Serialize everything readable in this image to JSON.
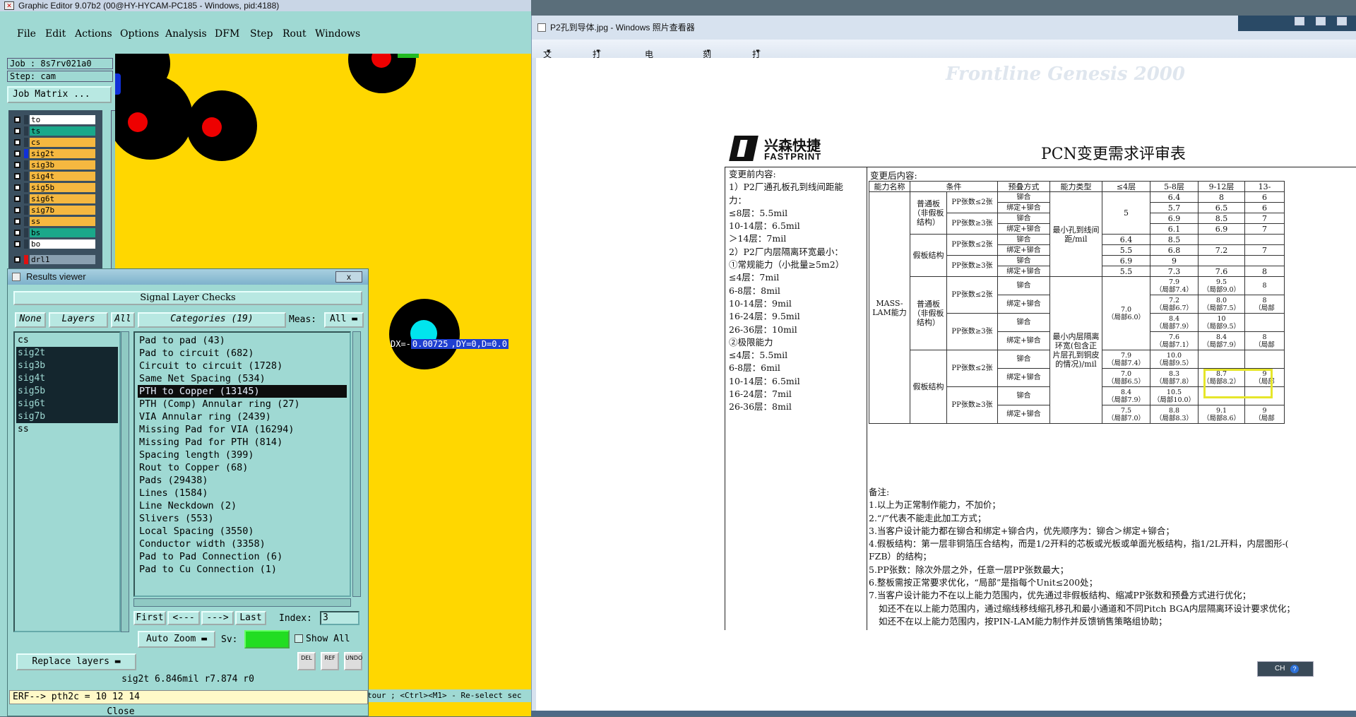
{
  "graphic_editor": {
    "title": "Graphic Editor 9.07b2 (00@HY-HYCAM-PC185 - Windows, pid:4188)",
    "menu": [
      "File",
      "Edit",
      "Actions",
      "Options",
      "Analysis",
      "DFM",
      "Step",
      "Rout",
      "Windows"
    ],
    "job": "Job : 8s7rv021a0",
    "step": "Step: cam",
    "job_matrix": "Job Matrix ...",
    "layers": [
      {
        "name": "to",
        "color": "#ffffff"
      },
      {
        "name": "ts",
        "color": "#1aa88a"
      },
      {
        "name": "cs",
        "color": "#f5b840"
      },
      {
        "name": "sig2t",
        "color": "#f5b840"
      },
      {
        "name": "sig3b",
        "color": "#f5b840"
      },
      {
        "name": "sig4t",
        "color": "#f5b840"
      },
      {
        "name": "sig5b",
        "color": "#f5b840"
      },
      {
        "name": "sig6t",
        "color": "#f5b840"
      },
      {
        "name": "sig7b",
        "color": "#f5b840"
      },
      {
        "name": "ss",
        "color": "#f5b840"
      },
      {
        "name": "bs",
        "color": "#1aa88a"
      },
      {
        "name": "bo",
        "color": "#ffffff"
      }
    ],
    "drill_layer": "drl1",
    "measure_label": {
      "prefix": "DX=-",
      "value": "0.00725",
      "rest": ",DY=0,D=0.0"
    },
    "bottom_strip": "tour ; <Ctrl><M1> - Re-select sec"
  },
  "results_viewer": {
    "title": "Results viewer",
    "close_label": "x",
    "header": "Signal Layer Checks",
    "btn_none": "None",
    "btn_layers": "Layers",
    "btn_all": "All",
    "btn_categories": "Categories (19)",
    "meas_label": "Meas:",
    "meas_value": "All",
    "layers": [
      {
        "name": "cs",
        "sel": false
      },
      {
        "name": "sig2t",
        "sel": true
      },
      {
        "name": "sig3b",
        "sel": true
      },
      {
        "name": "sig4t",
        "sel": true
      },
      {
        "name": "sig5b",
        "sel": true
      },
      {
        "name": "sig6t",
        "sel": true
      },
      {
        "name": "sig7b",
        "sel": true
      },
      {
        "name": "ss",
        "sel": false
      }
    ],
    "categories": [
      {
        "label": "Pad to pad (43)",
        "sel": false
      },
      {
        "label": "Pad to circuit (682)",
        "sel": false
      },
      {
        "label": "Circuit to circuit (1728)",
        "sel": false
      },
      {
        "label": "Same Net Spacing (534)",
        "sel": false
      },
      {
        "label": "PTH to Copper (13145)",
        "sel": true
      },
      {
        "label": "PTH (Comp) Annular ring (27)",
        "sel": false
      },
      {
        "label": "VIA Annular ring (2439)",
        "sel": false
      },
      {
        "label": "Missing Pad for VIA (16294)",
        "sel": false
      },
      {
        "label": "Missing Pad for PTH (814)",
        "sel": false
      },
      {
        "label": "Spacing length (399)",
        "sel": false
      },
      {
        "label": "Rout to Copper (68)",
        "sel": false
      },
      {
        "label": "Pads (29438)",
        "sel": false
      },
      {
        "label": "Lines (1584)",
        "sel": false
      },
      {
        "label": "Line Neckdown (2)",
        "sel": false
      },
      {
        "label": "Slivers (553)",
        "sel": false
      },
      {
        "label": "Local Spacing (3550)",
        "sel": false
      },
      {
        "label": "Conductor width (3358)",
        "sel": false
      },
      {
        "label": "Pad to Pad Connection (6)",
        "sel": false
      },
      {
        "label": "Pad to Cu Connection (1)",
        "sel": false
      }
    ],
    "nav": {
      "first": "First",
      "prev": "<---",
      "next": "--->",
      "last": "Last",
      "index_label": "Index:",
      "index_value": "3"
    },
    "auto_zoom": "Auto Zoom",
    "sv_label": "Sv:",
    "show_all": "Show All",
    "replace_layers": "Replace layers",
    "icon_btns": [
      "DEL",
      "REF",
      "UNDO"
    ],
    "status": "sig2t 6.846mil  r7.874  r0",
    "erf": "ERF--> pth2c = 10 12 14",
    "close": "Close"
  },
  "photo_viewer": {
    "title": "P2孔到导体.jpg - Windows 照片查看器",
    "menu": [
      "文件(F)",
      "打印(P)",
      "电子邮件(E)",
      "刻录(U)",
      "打开(O)"
    ],
    "ghost_text": "Frontline  Genesis 2000",
    "document": {
      "logo_cn": "兴森快捷",
      "logo_en": "FASTPRINT",
      "title": "PCN变更需求评审表",
      "before_heading": "变更前内容:",
      "after_heading": "变更后内容:",
      "before_lines": [
        "1）P2厂通孔板孔到线间距能",
        "力：",
        "≤8层：5.5mil",
        "10-14层：6.5mil",
        "＞14层：7mil",
        "2）P2厂内层隔离环宽最小：",
        "①常规能力（小批量≥5m2）",
        "≤4层：7mil",
        "6-8层：8mil",
        "10-14层：9mil",
        "16-24层：9.5mil",
        "26-36层：10mil",
        "②极限能力",
        "≤4层：5.5mil",
        "6-8层：6mil",
        "10-14层：6.5mil",
        "16-24层：7mil",
        "26-36层：8mil"
      ],
      "table_headers": [
        "能力名称",
        "条件",
        "预叠方式",
        "能力类型",
        "≤4层",
        "5-8层",
        "9-12层",
        "13-"
      ],
      "capability_name": "MASS-LAM能力",
      "board_normal": "普通板（非假板结构）",
      "board_dummy": "假板结构",
      "pp_le2": "PP张数≤2张",
      "pp_ge3": "PP张数≥3张",
      "m_rivet": "铆合",
      "m_bond_rivet": "绑定+铆合",
      "type_hole": "最小孔到线间距/mil",
      "type_ring": "最小内层隔离环宽(包含正片层孔到铜皮的情况)/mil",
      "hole_rows": [
        [
          "",
          "6.4",
          "8",
          "6"
        ],
        [
          "",
          "5.7",
          "6.5",
          "6"
        ],
        [
          "",
          "6.9",
          "8.5",
          "7"
        ],
        [
          "",
          "6.1",
          "6.9",
          "7"
        ],
        [
          "6.4",
          "8.5",
          "",
          ""
        ],
        [
          "5.5",
          "6.8",
          "7.2",
          "7"
        ],
        [
          "6.9",
          "9",
          "",
          ""
        ],
        [
          "5.5",
          "7.3",
          "7.6",
          "8"
        ]
      ],
      "hole_le4_normal": "5",
      "ring_le4_normal": "7.0",
      "ring_le4_normal_note": "（局部6.0）",
      "ring_rows": [
        [
          [
            "7.9",
            "（局部7.4）"
          ],
          [
            "9.5",
            "（局部9.0）"
          ],
          [
            "8",
            ""
          ]
        ],
        [
          [
            "7.2",
            "（局部6.7）"
          ],
          [
            "8.0",
            "（局部7.5）"
          ],
          [
            "8",
            "（局部"
          ]
        ],
        [
          [
            "8.4",
            "（局部7.9）"
          ],
          [
            "10",
            "（局部9.5）"
          ],
          [
            "",
            ""
          ]
        ],
        [
          [
            "7.6",
            "（局部7.1）"
          ],
          [
            "8.4",
            "（局部7.9）"
          ],
          [
            "8",
            "（局部"
          ]
        ]
      ],
      "ring_dummy_rows": [
        [
          [
            "7.9",
            "（局部7.4）"
          ],
          [
            "10.0",
            "（局部9.5）"
          ],
          [
            "",
            ""
          ],
          [
            "",
            ""
          ]
        ],
        [
          [
            "7.0",
            "（局部6.5）"
          ],
          [
            "8.3",
            "（局部7.8）"
          ],
          [
            "8.7",
            "（局部8.2）"
          ],
          [
            "9",
            "（局部"
          ]
        ],
        [
          [
            "8.4",
            "（局部7.9）"
          ],
          [
            "10.5",
            "（局部10.0）"
          ],
          [
            "",
            ""
          ],
          [
            "",
            ""
          ]
        ],
        [
          [
            "7.5",
            "（局部7.0）"
          ],
          [
            "8.8",
            "（局部8.3）"
          ],
          [
            "9.1",
            "（局部8.6）"
          ],
          [
            "9",
            "（局部"
          ]
        ]
      ],
      "remarks_heading": "备注:",
      "remarks": [
        "1.以上为正常制作能力，不加价；",
        "2.“/”代表不能走此加工方式；",
        "3.当客户设计能力都在铆合和绑定+铆合内，优先顺序为：铆合＞绑定+铆合；",
        "4.假板结构：第一层非铜箔压合结构，而是1/2开料的芯板或光板或单面光板结构，指1/2L开料，内层图形-(",
        "FZB）的结构；",
        "5.PP张数：除次外层之外，任意一层PP张数最大；",
        "6.整板需按正常要求优化，“局部”是指每个Unit≤200处；",
        "7.当客户设计能力不在以上能力范围内，优先通过非假板结构、缩减PP张数和预叠方式进行优化；"
      ],
      "remarks_indent": [
        "如还不在以上能力范围内，通过缩线移线缩孔移孔和最小通道和不同Pitch BGA内层隔离环设计要求优化；",
        "如还不在以上能力范围内，按PIN-LAM能力制作并反馈销售策略组协助；"
      ]
    }
  },
  "langbar": {
    "label": "CH"
  }
}
